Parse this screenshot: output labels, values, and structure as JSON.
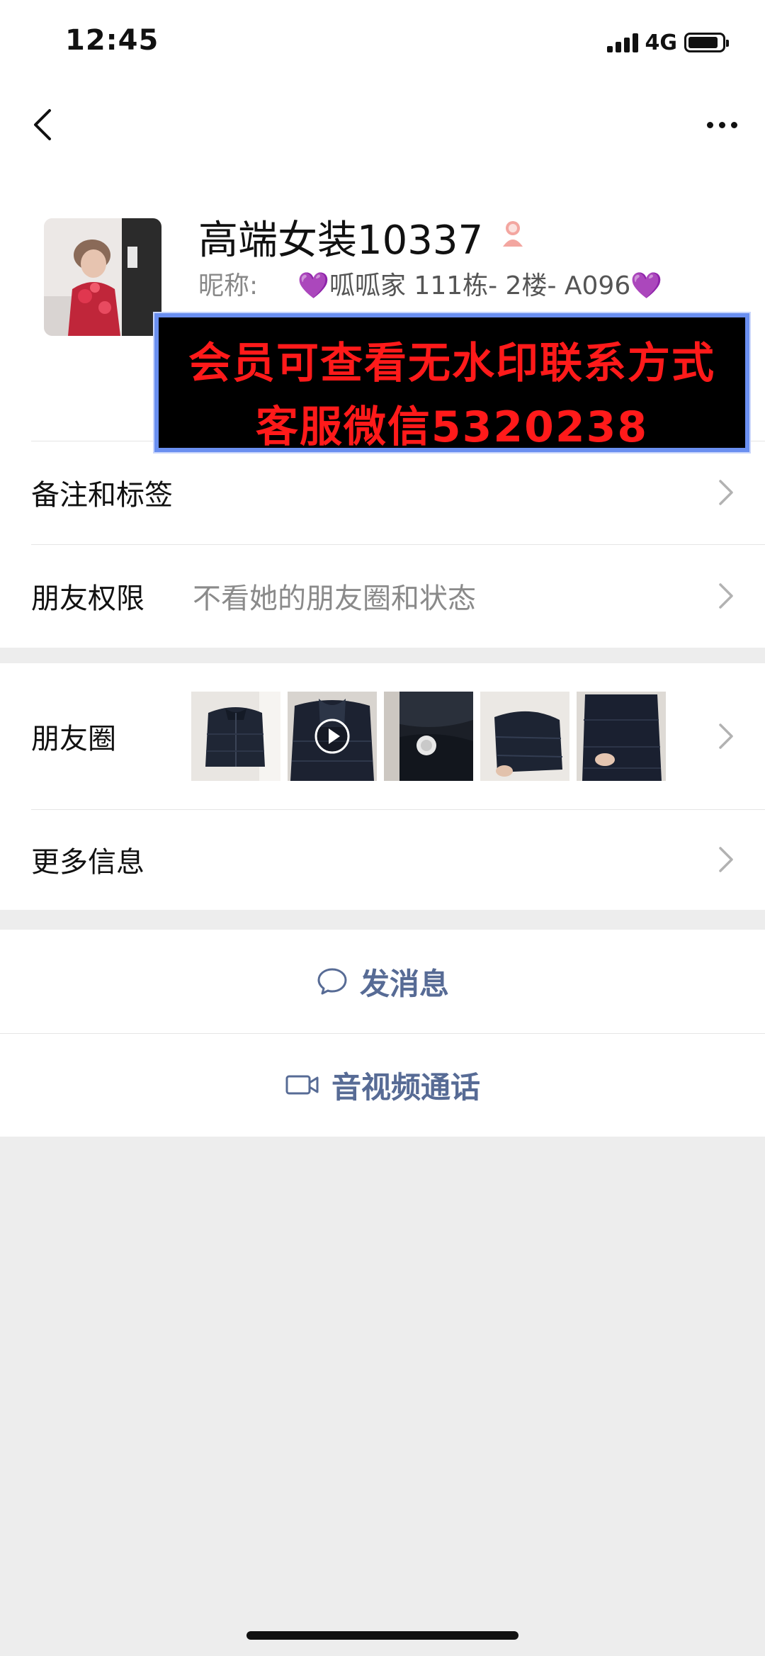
{
  "status_bar": {
    "time": "12:45",
    "network": "4G"
  },
  "nav": {
    "back_icon": "chevron-left-icon",
    "more_icon": "more-dots-icon"
  },
  "profile": {
    "name": "高端女装10337",
    "gender_icon": "female-icon",
    "nickname_label": "昵称:",
    "nickname_value": "💜呱呱家 111栋- 2楼- A096💜"
  },
  "watermark": {
    "line1": "会员可查看无水印联系方式",
    "line2": "客服微信5320238",
    "text_color": "#ff1a1a",
    "border_color": "#6a8ff0"
  },
  "cells": {
    "remarks": {
      "title": "备注和标签"
    },
    "permissions": {
      "title": "朋友权限",
      "value": "不看她的朋友圈和状态"
    },
    "moments": {
      "title": "朋友圈",
      "thumbnail_count": 5
    },
    "more_info": {
      "title": "更多信息"
    }
  },
  "actions": {
    "message": {
      "label": "发消息",
      "icon": "chat-bubble-icon"
    },
    "call": {
      "label": "音视频通话",
      "icon": "video-camera-icon"
    }
  },
  "colors": {
    "link_blue": "#576b95",
    "background": "#ededed"
  }
}
